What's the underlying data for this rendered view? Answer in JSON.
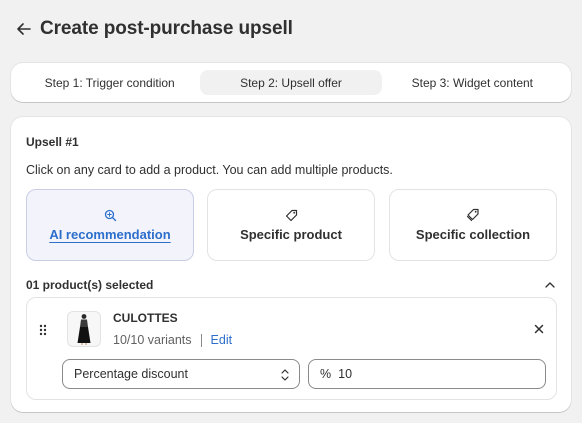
{
  "header": {
    "back_icon": "arrow-left-icon",
    "title": "Create post-purchase upsell"
  },
  "steps": [
    {
      "label": "Step 1: Trigger condition",
      "active": false
    },
    {
      "label": "Step 2: Upsell offer",
      "active": true
    },
    {
      "label": "Step 3: Widget content",
      "active": false
    }
  ],
  "upsell": {
    "title": "Upsell #1",
    "instructions": "Click on any card to add a product. You can add multiple products.",
    "options": [
      {
        "label": "AI recommendation",
        "icon": "search-sparkle-icon",
        "selected": true
      },
      {
        "label": "Specific product",
        "icon": "tag-icon",
        "selected": false
      },
      {
        "label": "Specific collection",
        "icon": "tags-icon",
        "selected": false
      }
    ],
    "selected_count": "01 product(s) selected",
    "product": {
      "name": "CULOTTES",
      "variants": "10/10 variants",
      "edit_label": "Edit"
    },
    "discount_type": "Percentage discount",
    "discount_prefix": "%",
    "discount_value": "10"
  },
  "colors": {
    "accent": "#2c6ecb",
    "background": "#f1f1f1",
    "selected_card_bg": "#f3f4fb"
  }
}
